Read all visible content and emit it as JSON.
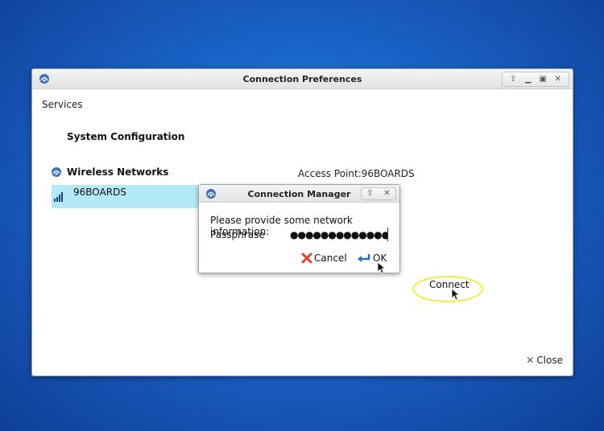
{
  "window": {
    "title": "Connection Preferences",
    "menu_label": "Services",
    "wm_buttons": [
      "up-arrow",
      "minimize",
      "maximize",
      "close"
    ]
  },
  "main": {
    "section_title": "System Configuration",
    "wireless_label": "Wireless Networks",
    "access_point_label": "Access Point:96BOARDS",
    "networks": [
      {
        "name": "96BOARDS",
        "selected": true
      }
    ],
    "connect_label": "Connect",
    "close_label": "Close"
  },
  "dialog": {
    "title": "Connection Manager",
    "prompt": "Please provide some network information:",
    "field_label": "Passphrase",
    "passphrase_value": "●●●●●●●●●●●●●●●●",
    "cancel_label": "Cancel",
    "ok_label": "OK"
  },
  "colors": {
    "desktop_bg": "#1a63c8",
    "selected_row": "#b4eaf7",
    "highlight_ring": "#f0ee3a",
    "cancel_icon": "#e0452a",
    "ok_icon": "#2b6bd6"
  }
}
